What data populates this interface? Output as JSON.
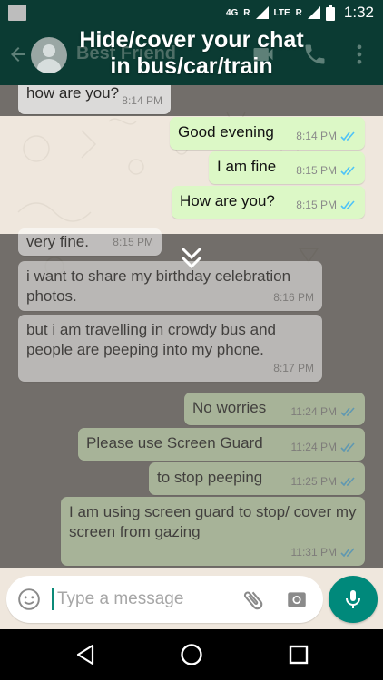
{
  "status_bar": {
    "network_label": "4G",
    "roaming_1": "R",
    "lte_label": "LTE",
    "roaming_2": "R",
    "time": "1:32"
  },
  "header": {
    "contact_name": "Best Friend",
    "overlay_title_line1": "Hide/cover your chat",
    "overlay_title_line2": "in bus/car/train"
  },
  "messages": [
    {
      "dir": "in",
      "text": "how are you?",
      "time": "8:14 PM"
    },
    {
      "dir": "out",
      "text": "Good evening",
      "time": "8:14 PM",
      "read": true
    },
    {
      "dir": "out",
      "text": "I am fine",
      "time": "8:15 PM",
      "read": true
    },
    {
      "dir": "out",
      "text": "How are you?",
      "time": "8:15 PM",
      "read": true
    },
    {
      "dir": "in",
      "text": "very fine.",
      "time": "8:15 PM"
    },
    {
      "dir": "in",
      "text": "i want to share my birthday celebration photos.",
      "time": "8:16 PM"
    },
    {
      "dir": "in",
      "text": "but i am travelling in crowdy bus and people are peeping into my phone.",
      "time": "8:17 PM"
    },
    {
      "dir": "out",
      "text": "No worries",
      "time": "11:24 PM",
      "read": true
    },
    {
      "dir": "out",
      "text": "Please use Screen Guard",
      "time": "11:24 PM",
      "read": true
    },
    {
      "dir": "out",
      "text": "to stop peeping",
      "time": "11:25 PM",
      "read": true
    },
    {
      "dir": "out",
      "text": "I am using screen guard to stop/ cover my screen from gazing",
      "time": "11:31 PM",
      "read": true
    }
  ],
  "composer": {
    "placeholder": "Type a message"
  },
  "icons": {
    "back": "arrow-back-icon",
    "video": "video-call-icon",
    "call": "phone-icon",
    "menu": "more-vert-icon",
    "emoji": "emoji-icon",
    "attach": "paperclip-icon",
    "camera": "camera-icon",
    "mic": "mic-icon",
    "nav_back": "triangle-back-icon",
    "nav_home": "circle-home-icon",
    "nav_recents": "square-recents-icon",
    "drag": "double-chevron-down-icon"
  },
  "colors": {
    "header_bg": "#0b3b33",
    "chat_bg": "#efe7dd",
    "outgoing_bubble": "#dcf8c6",
    "incoming_bubble": "#ffffff",
    "read_ticks": "#4fc3f7",
    "mic_button": "#00897b"
  }
}
